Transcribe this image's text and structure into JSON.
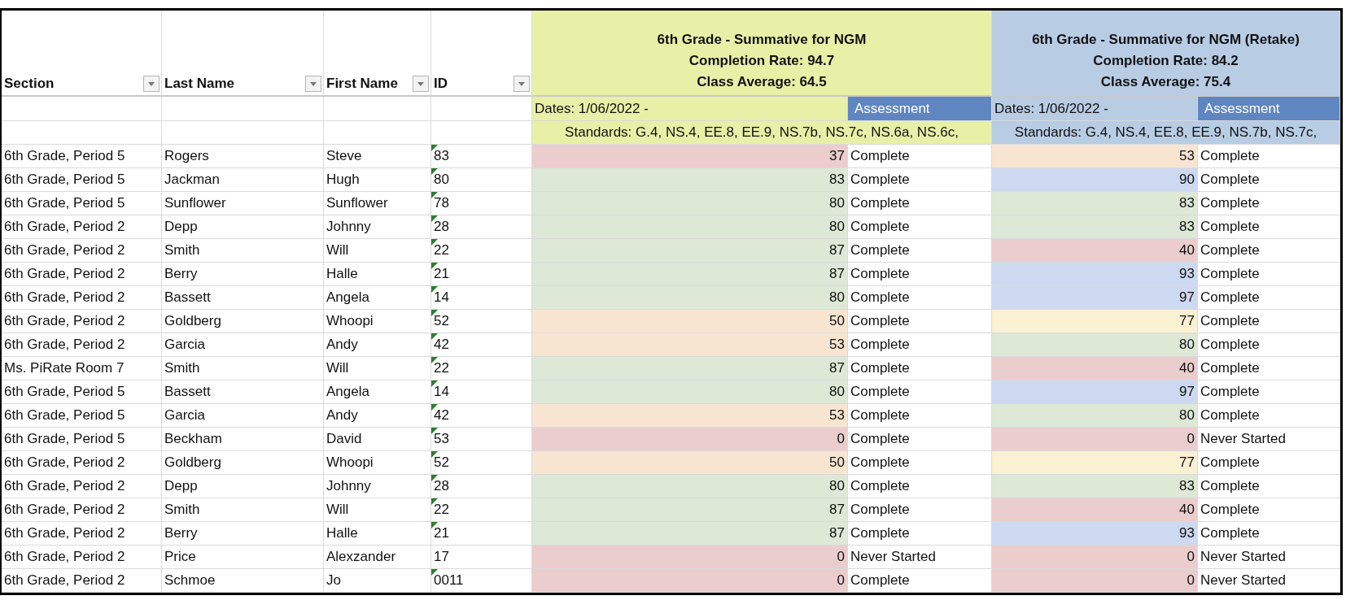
{
  "columns": [
    {
      "label": "Section"
    },
    {
      "label": "Last Name"
    },
    {
      "label": "First Name"
    },
    {
      "label": "ID"
    }
  ],
  "assessments": [
    {
      "title_lines": [
        "6th Grade - Summative for NGM",
        "Completion Rate: 94.7",
        "Class Average: 64.5"
      ],
      "color": "#e8f0a8",
      "dates": "Dates: 1/06/2022 -",
      "assessment_label": "Assessment",
      "standards": "Standards: G.4, NS.4, EE.8, EE.9, NS.7b, NS.7c, NS.6a, NS.6c,"
    },
    {
      "title_lines": [
        "6th Grade - Summative for NGM (Retake)",
        "Completion Rate: 84.2",
        "Class Average: 75.4"
      ],
      "color": "#b8cce4",
      "dates": "Dates: 1/06/2022 -",
      "assessment_label": "Assessment",
      "standards": "Standards: G.4, NS.4, EE.8, EE.9, NS.7b, NS.7c,"
    }
  ],
  "rows": [
    {
      "section": "6th Grade, Period 5",
      "last": "Rogers",
      "first": "Steve",
      "id": "83",
      "flagged": true,
      "scores": [
        {
          "score": "37",
          "color": "#ebcdcd",
          "status": "Complete"
        },
        {
          "score": "53",
          "color": "#f7e5d2",
          "status": "Complete"
        }
      ]
    },
    {
      "section": "6th Grade, Period 5",
      "last": "Jackman",
      "first": "Hugh",
      "id": "80",
      "flagged": true,
      "scores": [
        {
          "score": "83",
          "color": "#dde8d6",
          "status": "Complete"
        },
        {
          "score": "90",
          "color": "#cdd9f0",
          "status": "Complete"
        }
      ]
    },
    {
      "section": "6th Grade, Period 5",
      "last": "Sunflower",
      "first": "Sunflower",
      "id": "78",
      "flagged": true,
      "scores": [
        {
          "score": "80",
          "color": "#dde8d6",
          "status": "Complete"
        },
        {
          "score": "83",
          "color": "#dde8d6",
          "status": "Complete"
        }
      ]
    },
    {
      "section": "6th Grade, Period 2",
      "last": "Depp",
      "first": "Johnny",
      "id": "28",
      "flagged": true,
      "scores": [
        {
          "score": "80",
          "color": "#dde8d6",
          "status": "Complete"
        },
        {
          "score": "83",
          "color": "#dde8d6",
          "status": "Complete"
        }
      ]
    },
    {
      "section": "6th Grade, Period 2",
      "last": "Smith",
      "first": "Will",
      "id": "22",
      "flagged": true,
      "scores": [
        {
          "score": "87",
          "color": "#dde8d6",
          "status": "Complete"
        },
        {
          "score": "40",
          "color": "#ebcdcd",
          "status": "Complete"
        }
      ]
    },
    {
      "section": "6th Grade, Period 2",
      "last": "Berry",
      "first": "Halle",
      "id": "21",
      "flagged": true,
      "scores": [
        {
          "score": "87",
          "color": "#dde8d6",
          "status": "Complete"
        },
        {
          "score": "93",
          "color": "#cdd9f0",
          "status": "Complete"
        }
      ]
    },
    {
      "section": "6th Grade, Period 2",
      "last": "Bassett",
      "first": "Angela",
      "id": "14",
      "flagged": true,
      "scores": [
        {
          "score": "80",
          "color": "#dde8d6",
          "status": "Complete"
        },
        {
          "score": "97",
          "color": "#cdd9f0",
          "status": "Complete"
        }
      ]
    },
    {
      "section": "6th Grade, Period 2",
      "last": "Goldberg",
      "first": "Whoopi",
      "id": "52",
      "flagged": true,
      "scores": [
        {
          "score": "50",
          "color": "#f7e5d2",
          "status": "Complete"
        },
        {
          "score": "77",
          "color": "#faf0d2",
          "status": "Complete"
        }
      ]
    },
    {
      "section": "6th Grade, Period 2",
      "last": "Garcia",
      "first": "Andy",
      "id": "42",
      "flagged": true,
      "scores": [
        {
          "score": "53",
          "color": "#f7e5d2",
          "status": "Complete"
        },
        {
          "score": "80",
          "color": "#dde8d6",
          "status": "Complete"
        }
      ]
    },
    {
      "section": "Ms. PiRate Room 7",
      "last": "Smith",
      "first": "Will",
      "id": "22",
      "flagged": true,
      "scores": [
        {
          "score": "87",
          "color": "#dde8d6",
          "status": "Complete"
        },
        {
          "score": "40",
          "color": "#ebcdcd",
          "status": "Complete"
        }
      ]
    },
    {
      "section": "6th Grade, Period 5",
      "last": "Bassett",
      "first": "Angela",
      "id": "14",
      "flagged": true,
      "scores": [
        {
          "score": "80",
          "color": "#dde8d6",
          "status": "Complete"
        },
        {
          "score": "97",
          "color": "#cdd9f0",
          "status": "Complete"
        }
      ]
    },
    {
      "section": "6th Grade, Period 5",
      "last": "Garcia",
      "first": "Andy",
      "id": "42",
      "flagged": true,
      "scores": [
        {
          "score": "53",
          "color": "#f7e5d2",
          "status": "Complete"
        },
        {
          "score": "80",
          "color": "#dde8d6",
          "status": "Complete"
        }
      ]
    },
    {
      "section": "6th Grade, Period 5",
      "last": "Beckham",
      "first": "David",
      "id": "53",
      "flagged": true,
      "scores": [
        {
          "score": "0",
          "color": "#ebcdcd",
          "status": "Complete"
        },
        {
          "score": "0",
          "color": "#ebcdcd",
          "status": "Never Started"
        }
      ]
    },
    {
      "section": "6th Grade, Period 2",
      "last": "Goldberg",
      "first": "Whoopi",
      "id": "52",
      "flagged": true,
      "scores": [
        {
          "score": "50",
          "color": "#f7e5d2",
          "status": "Complete"
        },
        {
          "score": "77",
          "color": "#faf0d2",
          "status": "Complete"
        }
      ]
    },
    {
      "section": "6th Grade, Period 2",
      "last": "Depp",
      "first": "Johnny",
      "id": "28",
      "flagged": true,
      "scores": [
        {
          "score": "80",
          "color": "#dde8d6",
          "status": "Complete"
        },
        {
          "score": "83",
          "color": "#dde8d6",
          "status": "Complete"
        }
      ]
    },
    {
      "section": "6th Grade, Period 2",
      "last": "Smith",
      "first": "Will",
      "id": "22",
      "flagged": true,
      "scores": [
        {
          "score": "87",
          "color": "#dde8d6",
          "status": "Complete"
        },
        {
          "score": "40",
          "color": "#ebcdcd",
          "status": "Complete"
        }
      ]
    },
    {
      "section": "6th Grade, Period 2",
      "last": "Berry",
      "first": "Halle",
      "id": "21",
      "flagged": true,
      "scores": [
        {
          "score": "87",
          "color": "#dde8d6",
          "status": "Complete"
        },
        {
          "score": "93",
          "color": "#cdd9f0",
          "status": "Complete"
        }
      ]
    },
    {
      "section": "6th Grade, Period 2",
      "last": "Price",
      "first": "Alexzander",
      "id": "17",
      "flagged": false,
      "scores": [
        {
          "score": "0",
          "color": "#ebcdcd",
          "status": "Never Started"
        },
        {
          "score": "0",
          "color": "#ebcdcd",
          "status": "Never Started"
        }
      ]
    },
    {
      "section": "6th Grade, Period 2",
      "last": "Schmoe",
      "first": "Jo",
      "id": "0011",
      "flagged": true,
      "scores": [
        {
          "score": "0",
          "color": "#ebcdcd",
          "status": "Complete"
        },
        {
          "score": "0",
          "color": "#ebcdcd",
          "status": "Never Started"
        }
      ]
    }
  ]
}
